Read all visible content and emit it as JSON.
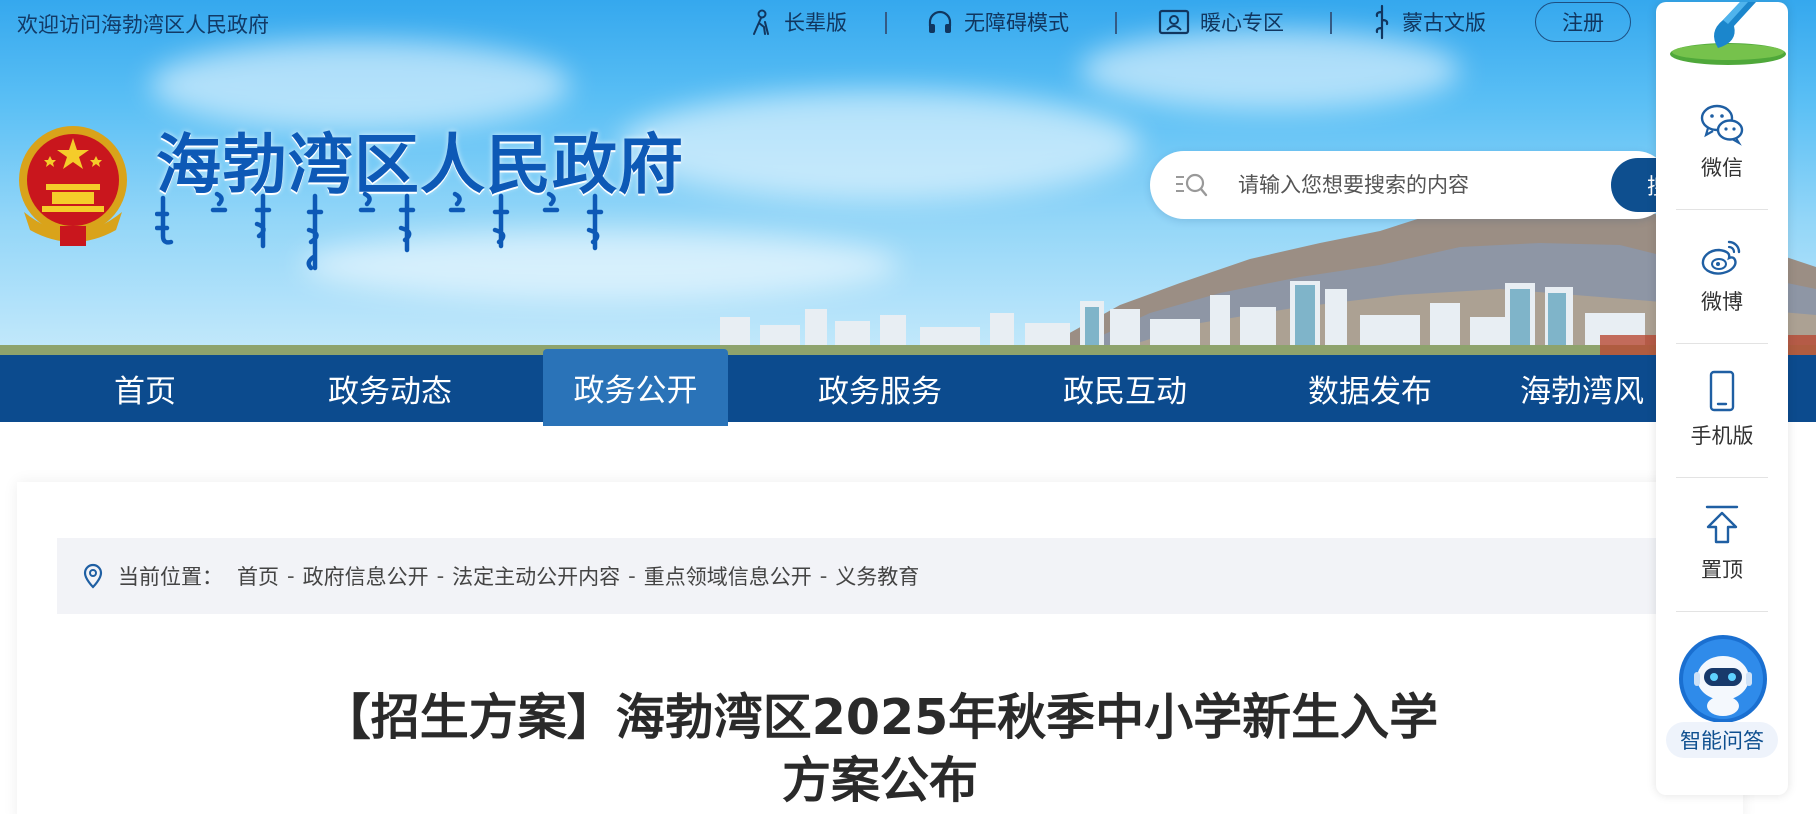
{
  "header": {
    "welcome": "欢迎访问海勃湾区人民政府",
    "utilities": [
      {
        "label": "长辈版",
        "icon": "elder-icon"
      },
      {
        "label": "无障碍模式",
        "icon": "headphones-icon"
      },
      {
        "label": "暖心专区",
        "icon": "person-card-icon"
      },
      {
        "label": "蒙古文版",
        "icon": "mongolian-script-icon"
      }
    ],
    "register": "注册",
    "site_title": "海勃湾区人民政府",
    "mongolian_title": "ᠬᠠᠶᠢᠪᠤᠸᠠᠨ ᠲᠣᠭᠣᠷᠢᠭ ᠦᠨ ᠠᠷᠠᠳ ᠤᠨ ᠵᠠᠰᠠᠭ ᠤᠨ ᠣᠷᠳᠣᠨ"
  },
  "search": {
    "placeholder": "请输入您想要搜索的内容",
    "button": "搜"
  },
  "nav": {
    "items": [
      "首页",
      "政务动态",
      "政务公开",
      "政务服务",
      "政民互动",
      "数据发布",
      "海勃湾风"
    ],
    "active": "政务公开"
  },
  "breadcrumb": {
    "label": "当前位置：",
    "items": [
      "首页",
      "政府信息公开",
      "法定主动公开内容",
      "重点领域信息公开",
      "义务教育"
    ],
    "separator": "-"
  },
  "article": {
    "title_line1": "【招生方案】海勃湾区2025年秋季中小学新生入学",
    "title_line2": "方案公布"
  },
  "sidebar": {
    "items": [
      {
        "label": "微信",
        "icon": "wechat-icon"
      },
      {
        "label": "微博",
        "icon": "weibo-icon"
      },
      {
        "label": "手机版",
        "icon": "mobile-icon"
      },
      {
        "label": "置顶",
        "icon": "back-to-top-icon"
      }
    ],
    "ai_label": "智能问答"
  },
  "colors": {
    "nav_bg": "#0c4b8e",
    "nav_active": "#2a73b8",
    "title_blue": "#0d59b6",
    "breadcrumb_bg": "#f2f3f7"
  }
}
